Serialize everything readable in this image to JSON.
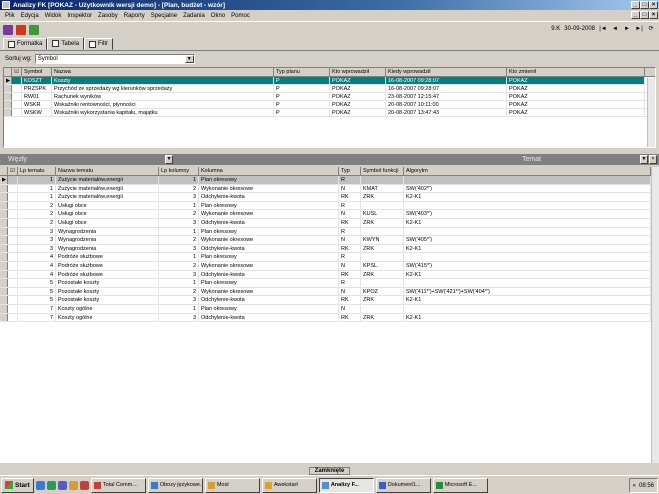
{
  "window": {
    "title": "Analizy FK [POKAZ - Użytkownik wersji demo] - [Plan, budżet - wzór]"
  },
  "menu": [
    "Plik",
    "Edycja",
    "Widok",
    "Inspektor",
    "Zasoby",
    "Raporty",
    "Specjalne",
    "Zadania",
    "Okno",
    "Pomoc"
  ],
  "status": {
    "version": "9.K",
    "date": "30-09-2008",
    "nav": [
      "|◄",
      "◄",
      "►",
      "►|",
      "⟳"
    ]
  },
  "tabs": [
    "Formatka",
    "Tabela",
    "Filtr"
  ],
  "sort": {
    "label": "Sortuj wg:",
    "value": "Symbol"
  },
  "grid1": {
    "headers": [
      "",
      "Symbol",
      "Nazwa",
      "Typ planu",
      "Kto wprowadził",
      "Kiedy wprowadził",
      "Kto zmienił"
    ],
    "rows": [
      [
        "KOSZT",
        "Koszty",
        "P",
        "POKAZ",
        "16-08-2007 09:28:07",
        "POKAZ"
      ],
      [
        "PRZSPK",
        "Przychód ze sprzedaży wg kierunków sprzedaży",
        "P",
        "POKAZ",
        "16-08-2007 09:28:07",
        "POKAZ"
      ],
      [
        "RW01",
        "Rachunek wyników",
        "P",
        "POKAZ",
        "23-08-2007 12:15:47",
        "POKAZ"
      ],
      [
        "WSKR",
        "Wskaźniki rentowności, płynności",
        "P",
        "POKAZ",
        "20-08-2007 10:11:00",
        "POKAZ"
      ],
      [
        "WSKW",
        "Wskaźniki wykorzystania kapitału, majątku",
        "P",
        "POKAZ",
        "20-08-2007 13:47:43",
        "POKAZ"
      ]
    ]
  },
  "panel": {
    "left": "Węzły",
    "right": "Temat"
  },
  "grid2": {
    "headers": [
      "",
      "Lp tematu",
      "Nazwa tematu",
      "Lp kolumny",
      "Kolumna",
      "Typ",
      "Symbol funkcji",
      "Algorytm"
    ],
    "rows": [
      [
        "1",
        "Zużycie materiałów,energii",
        "1",
        "Plan okresowy",
        "R",
        "",
        ""
      ],
      [
        "1",
        "Zużycie materiałów,energii",
        "2",
        "Wykonanie okresowe",
        "N",
        "KMAT",
        "SW('402*')"
      ],
      [
        "1",
        "Zużycie materiałów,energii",
        "3",
        "Odchylenie-kwota",
        "RK",
        "ZRK",
        "K2-K1"
      ],
      [
        "2",
        "Usługi obce",
        "1",
        "Plan okresowy",
        "R",
        "",
        ""
      ],
      [
        "2",
        "Usługi obce",
        "2",
        "Wykonanie okresowe",
        "N",
        "KUSL",
        "SW('403*')"
      ],
      [
        "2",
        "Usługi obce",
        "3",
        "Odchylenie-kwota",
        "RK",
        "ZRK",
        "K2-K1"
      ],
      [
        "3",
        "Wynagrodzenia",
        "1",
        "Plan okresowy",
        "R",
        "",
        ""
      ],
      [
        "3",
        "Wynagrodzenia",
        "2",
        "Wykonanie okresowe",
        "N",
        "KWYN",
        "SW('405*')"
      ],
      [
        "3",
        "Wynagrodzenia",
        "3",
        "Odchylenie-kwota",
        "RK",
        "ZRK",
        "K2-K1"
      ],
      [
        "4",
        "Podróże służbowe",
        "1",
        "Plan okresowy",
        "R",
        "",
        ""
      ],
      [
        "4",
        "Podróże służbowe",
        "2",
        "Wykonanie okresowe",
        "N",
        "KPSL",
        "SW('415*')"
      ],
      [
        "4",
        "Podróże służbowe",
        "3",
        "Odchylenie-kwota",
        "RK",
        "ZRK",
        "K2-K1"
      ],
      [
        "5",
        "Pozostałe koszty",
        "1",
        "Plan okresowy",
        "R",
        "",
        ""
      ],
      [
        "5",
        "Pozostałe koszty",
        "2",
        "Wykonanie okresowe",
        "N",
        "KPOZ",
        "SW('411*')+SW('421*')+SW('404*')"
      ],
      [
        "5",
        "Pozostałe koszty",
        "3",
        "Odchylenie-kwota",
        "RK",
        "ZRK",
        "K2-K1"
      ],
      [
        "7",
        "Koszty ogólne",
        "1",
        "Plan okresowy",
        "N",
        "",
        ""
      ],
      [
        "7",
        "Koszty ogólne",
        "3",
        "Odchylenie-kwota",
        "RK",
        "ZRK",
        "K2-K1"
      ]
    ]
  },
  "closed_tab": "Zamknięte",
  "taskbar": {
    "start": "Start",
    "tasks": [
      "Total Comm...",
      "Obozy językowe...",
      "Most",
      "Awekstart",
      "Analizy F...",
      "Dokument1...",
      "Microsoft E..."
    ],
    "clock": "08:56"
  }
}
